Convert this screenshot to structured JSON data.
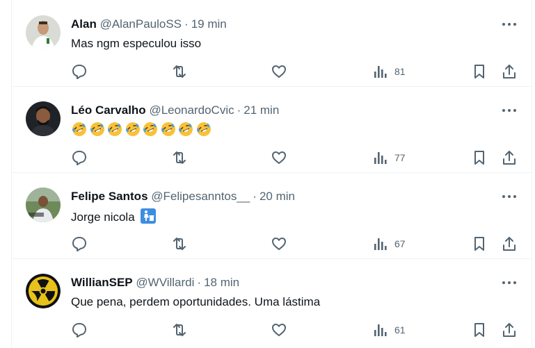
{
  "posts": [
    {
      "name": "Alan",
      "handle": "@AlanPauloSS",
      "separator": "·",
      "time": "19 min",
      "text": "Mas ngm especulou isso",
      "views": "81",
      "avatar": "avatar-photo"
    },
    {
      "name": "Léo Carvalho",
      "handle": "@LeonardoCvic",
      "separator": "·",
      "time": "21 min",
      "text": "🤣🤣🤣🤣🤣🤣🤣🤣",
      "emoji_count": 8,
      "views": "77",
      "avatar": "avatar-photo"
    },
    {
      "name": "Felipe Santos",
      "handle": "@Felipesanntos__",
      "separator": "·",
      "time": "20 min",
      "text": "Jorge nicola",
      "text_emoji": "🚮",
      "views": "67",
      "avatar": "avatar-photo"
    },
    {
      "name": "WillianSEP",
      "handle": "@WVillardi",
      "separator": "·",
      "time": "18 min",
      "text": "Que pena, perdem oportunidades. Uma lástima",
      "views": "61",
      "avatar": "radiation-symbol-avatar"
    }
  ],
  "icons": [
    "more-icon",
    "reply-icon",
    "repost-icon",
    "like-icon",
    "views-icon",
    "bookmark-icon",
    "share-icon"
  ],
  "colors": {
    "text": "#0f1419",
    "secondary": "#536471",
    "border": "#eff3f4",
    "emoji_face": "#f7c23a",
    "emoji_tears": "#4aa3df",
    "radiation_yellow": "#e8c21a"
  }
}
